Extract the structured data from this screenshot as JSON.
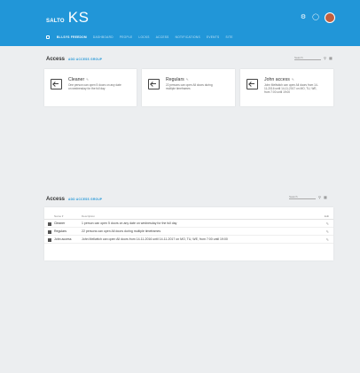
{
  "app": {
    "brand_prefix": "SALTO",
    "brand_name": "KS"
  },
  "header": {
    "icons": [
      "gear-icon",
      "chat-icon",
      "user-avatar"
    ]
  },
  "nav": {
    "site_label": "Bli-Sys Freedom",
    "items": [
      "Dashboard",
      "People",
      "Locks",
      "Access",
      "Notifications",
      "Events",
      "Site"
    ]
  },
  "top_section": {
    "title": "Access",
    "add_label": "Add access group",
    "search_placeholder": "Search",
    "cards": [
      {
        "title": "Cleaner",
        "description": "One person can open 5 doors on any date on wednesday for the full day"
      },
      {
        "title": "Regulars",
        "description": "22 persons can open All doors during multiple timeframes"
      },
      {
        "title": "John access",
        "description": "John Mellwitch can open All doors from 14-11-2016 until 14-11-2017 on MO, TU, WE, from 7:00 until 19:00"
      }
    ]
  },
  "bottom_section": {
    "title": "Access",
    "add_label": "Add access group",
    "search_placeholder": "Search",
    "columns": {
      "name": "Name ▾",
      "description": "Description",
      "edit": "Edit"
    },
    "rows": [
      {
        "name": "Cleaner",
        "description": "1 person can open 5 doors on any date on wednesday for the full day"
      },
      {
        "name": "Regulars",
        "description": "22 persons can open All doors during multiple timeframes"
      },
      {
        "name": "John access",
        "description": "John Mellwitch can open All doors from 14-11-2016 until 14-11-2017 on MO, TU, WE, from 7:00 until 19:00"
      }
    ]
  },
  "colors": {
    "header": "#2196d8",
    "accent": "#2196d8",
    "background": "#eceef0"
  }
}
